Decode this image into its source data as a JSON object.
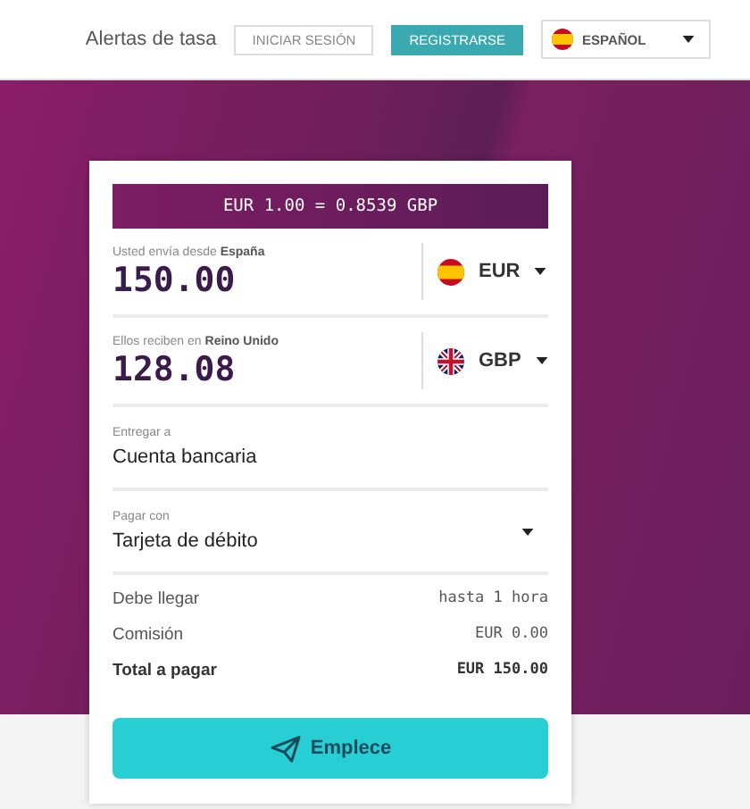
{
  "header": {
    "rate_alerts_link": "Alertas de tasa",
    "login_button": "INICIAR SESIÓN",
    "register_button": "REGISTRARSE",
    "language": {
      "flag": {
        "kind": "es"
      },
      "label": "ESPAÑOL"
    }
  },
  "converter": {
    "rate": "EUR 1.00 = 0.8539 GBP",
    "amounts": [
      {
        "label": "Usted envía desde **España**",
        "value": "150.00",
        "currency": "EUR",
        "flag": {
          "kind": "es"
        }
      },
      {
        "label": "Ellos reciben en **Reino Unido**",
        "value": "128.08",
        "currency": "GBP",
        "flag": {
          "kind": "uk"
        }
      }
    ],
    "options": [
      {
        "label": "Entregar a",
        "value": "Cuenta bancaria",
        "dropdown": false
      },
      {
        "label": "Pagar con",
        "value": "Tarjeta de débito",
        "dropdown": true
      }
    ],
    "summary": [
      {
        "label": "Debe llegar",
        "value": "hasta 1 hora",
        "emphasis": false
      },
      {
        "label": "Comisión",
        "value": "EUR 0.00",
        "emphasis": false
      },
      {
        "label": "Total a pagar",
        "value": "EUR 150.00",
        "emphasis": true
      }
    ],
    "submit_button": "Emplece"
  }
}
